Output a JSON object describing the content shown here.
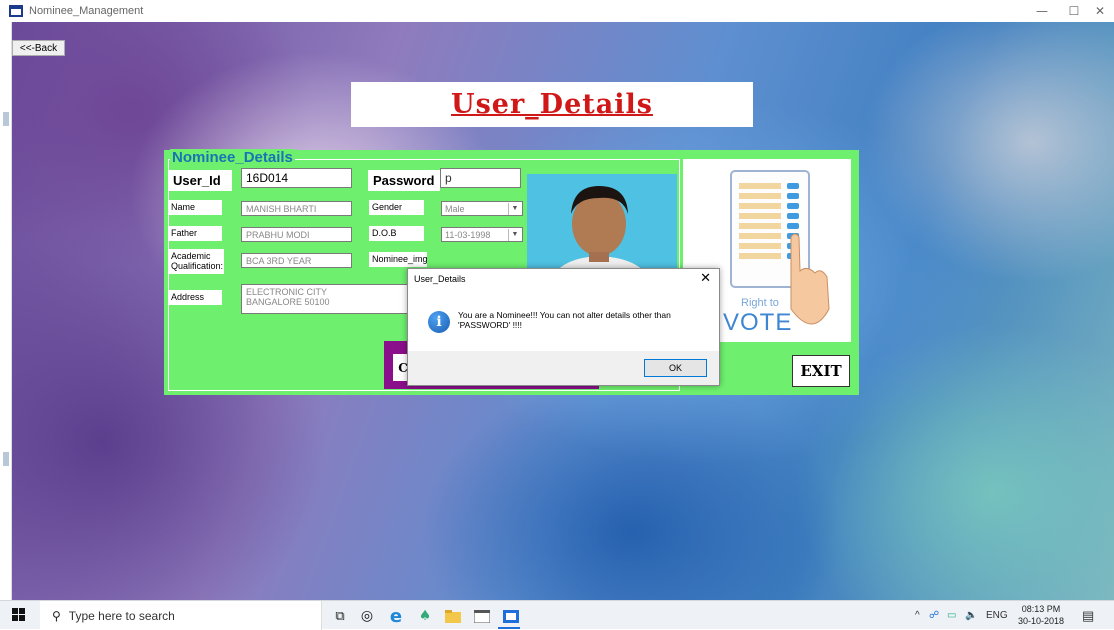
{
  "window": {
    "title": "Nominee_Management",
    "back_label": "<<-Back",
    "minimize": "—",
    "maximize": "☐",
    "close": "✕"
  },
  "banner": {
    "title": "User_Details"
  },
  "form": {
    "group_title": "Nominee_Details",
    "user_id": {
      "label": "User_Id",
      "value": "16D014"
    },
    "password": {
      "label": "Password",
      "value": "p"
    },
    "name": {
      "label": "Name",
      "value": "MANISH BHARTI"
    },
    "gender": {
      "label": "Gender",
      "value": "Male"
    },
    "father": {
      "label": "Father",
      "value": "PRABHU MODI"
    },
    "dob": {
      "label": "D.O.B",
      "value": "11-03-1998"
    },
    "academic": {
      "label_line1": "Academic",
      "label_line2": "Qualification:",
      "value": "BCA 3RD YEAR"
    },
    "nominee_img": {
      "label": "Nominee_img"
    },
    "address": {
      "label": "Address",
      "line1": "ELECTRONIC CITY",
      "line2": "BANGALORE 50100"
    },
    "partial_button_label": "C",
    "exit_label": "EXIT"
  },
  "vote_image": {
    "text_line1": "Right to",
    "text_line2": "VOTE"
  },
  "dialog": {
    "title": "User_Details",
    "close": "✕",
    "message_line1": "You are a Nominee!!! You can not alter details other than",
    "message_line2": "'PASSWORD' !!!!",
    "ok_label": "OK",
    "icon": "info-icon"
  },
  "taskbar": {
    "search_placeholder": "Type here to search",
    "tray": {
      "language": "ENG",
      "time": "08:13 PM",
      "date": "30-10-2018"
    }
  },
  "colors": {
    "panel_green": "#6ef06e",
    "group_title_blue": "#1874b4",
    "banner_red": "#d01818",
    "purple": "#8a0f8a"
  }
}
